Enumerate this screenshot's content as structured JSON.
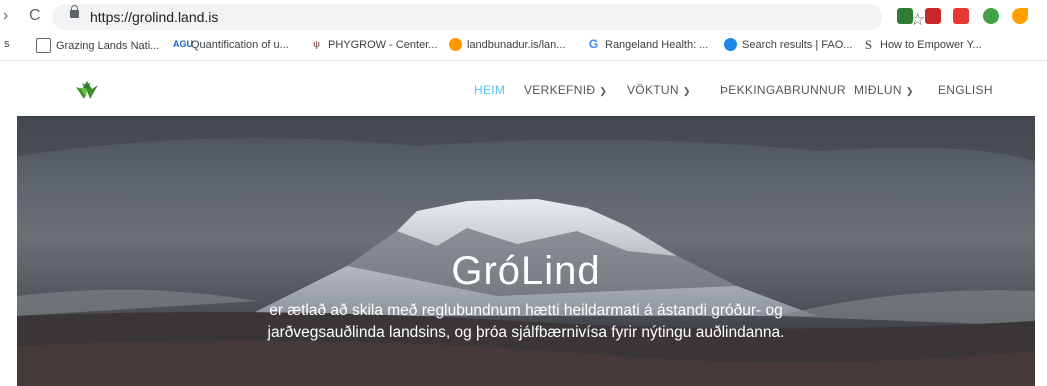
{
  "browser": {
    "back": "›",
    "reload": "C",
    "url": "https://grolind.land.is",
    "extensions": [
      {
        "name": "new-extension-icon",
        "color": "#2e7d32"
      },
      {
        "name": "mendeley-icon",
        "color": "#c62828"
      },
      {
        "name": "todoist-icon",
        "color": "#e53935"
      },
      {
        "name": "evernote-icon",
        "color": "#43a047"
      },
      {
        "name": "bird-extension-icon",
        "color": "#ffa000"
      }
    ],
    "bookmarks": [
      {
        "label": "s"
      },
      {
        "label": "Grazing Lands Nati..."
      },
      {
        "label": "Quantification of u..."
      },
      {
        "label": "PHYGROW - Center..."
      },
      {
        "label": "landbunadur.is/lan..."
      },
      {
        "label": "Rangeland Health: ..."
      },
      {
        "label": "Search results | FAO..."
      },
      {
        "label": "How to Empower Y..."
      }
    ]
  },
  "site": {
    "menu": {
      "heim": "HEIM",
      "verkefnid": "VERKEFNIÐ",
      "voktun": "VÖKTUN",
      "thekkingabrunnur": "ÞEKKINGABRUNNUR",
      "midlun": "MIÐLUN",
      "english": "ENGLISH"
    },
    "hero": {
      "title": "GróLind",
      "line1": "er ætlað að skila með reglubundnum hætti heildarmati á ástandi gróður- og",
      "line2": "jarðvegsauðlinda landsins, og þróa sjálfbærnivísa fyrir nýtingu auðlindanna."
    },
    "accent": "#4fc3f7"
  }
}
